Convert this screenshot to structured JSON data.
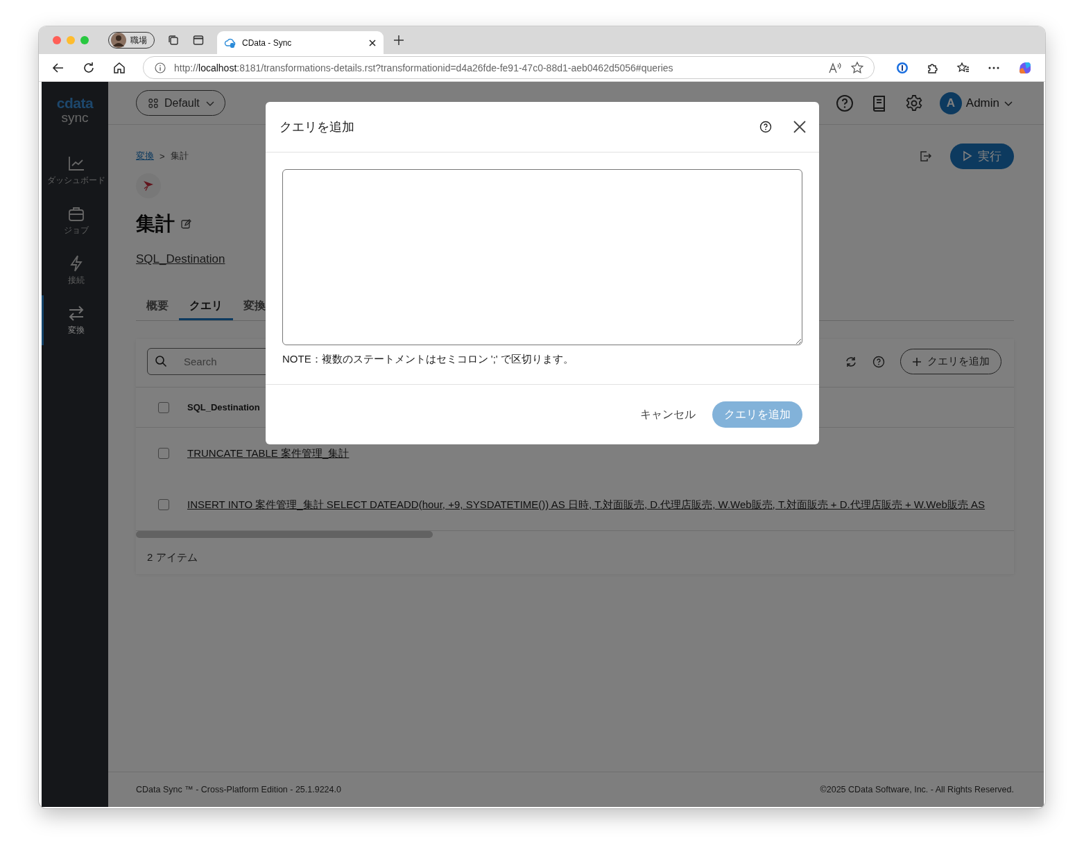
{
  "browser": {
    "profile": "職場",
    "tab": {
      "title": "CData - Sync"
    },
    "url": "http://**localhost**:8181/transformations-details.rst?transformationid=d4a26fde-fe91-47c0-88d1-aeb0462d5056#queries"
  },
  "sidebar": {
    "logo": "cdata",
    "product": "sync",
    "items": [
      {
        "label": "ダッシュボード",
        "selected": false
      },
      {
        "label": "ジョブ",
        "selected": false
      },
      {
        "label": "接続",
        "selected": false
      },
      {
        "label": "変換",
        "selected": true
      }
    ]
  },
  "header": {
    "workspace": "Default",
    "user": {
      "initial": "A",
      "name": "Admin"
    }
  },
  "breadcrumb": {
    "parent": "変換",
    "separator": ">",
    "current": "集計"
  },
  "run_button": "実行",
  "title": "集計",
  "connection": "SQL_Destination",
  "tabs": [
    {
      "label": "概要",
      "selected": false
    },
    {
      "label": "クエリ",
      "selected": true
    },
    {
      "label": "変換",
      "selected": false
    }
  ],
  "queries": {
    "search_placeholder": "Search",
    "add_button": "クエリを追加",
    "column": "SQL_Destination",
    "header_checked": false,
    "rows": [
      {
        "text": "TRUNCATE TABLE 案件管理_集計",
        "checked": false
      },
      {
        "text": "INSERT INTO 案件管理_集計 SELECT DATEADD(hour, +9, SYSDATETIME()) AS 日時, T.対面販売, D.代理店販売, W.Web販売, T.対面販売 + D.代理店販売 + W.Web販売 AS",
        "checked": false
      }
    ],
    "count": "2 アイテム"
  },
  "footer": {
    "left": "CData Sync ™ - Cross-Platform Edition - 25.1.9224.0",
    "right": "©2025 CData Software, Inc. - All Rights Reserved."
  },
  "dialog": {
    "title": "クエリを追加",
    "note": "NOTE：複数のステートメントはセミコロン ';' で区切ります。",
    "cancel": "キャンセル",
    "submit": "クエリを追加",
    "submit_disabled": true
  }
}
